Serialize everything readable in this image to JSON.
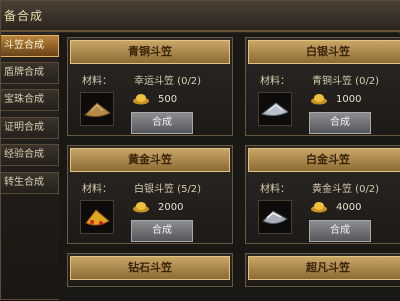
{
  "window": {
    "title": "备合成"
  },
  "sidebar": {
    "items": [
      {
        "label": "斗笠合成",
        "active": true
      },
      {
        "label": "盾牌合成"
      },
      {
        "label": "宝珠合成"
      },
      {
        "label": "证明合成"
      },
      {
        "label": "经验合成"
      },
      {
        "label": "转生合成"
      }
    ]
  },
  "cards": [
    {
      "name": "青铜斗笠",
      "material_label": "材料：",
      "material": "幸运斗笠 (0/2)",
      "price": "500",
      "button": "合成"
    },
    {
      "name": "白银斗笠",
      "material_label": "材料：",
      "material": "青铜斗笠 (0/2)",
      "price": "1000",
      "button": "合成"
    },
    {
      "name": "黄金斗笠",
      "material_label": "材料：",
      "material": "白银斗笠 (5/2)",
      "price": "2000",
      "button": "合成"
    },
    {
      "name": "白金斗笠",
      "material_label": "材料：",
      "material": "黄金斗笠 (0/2)",
      "price": "4000",
      "button": "合成"
    },
    {
      "name": "钻石斗笠"
    },
    {
      "name": "超凡斗笠"
    }
  ]
}
